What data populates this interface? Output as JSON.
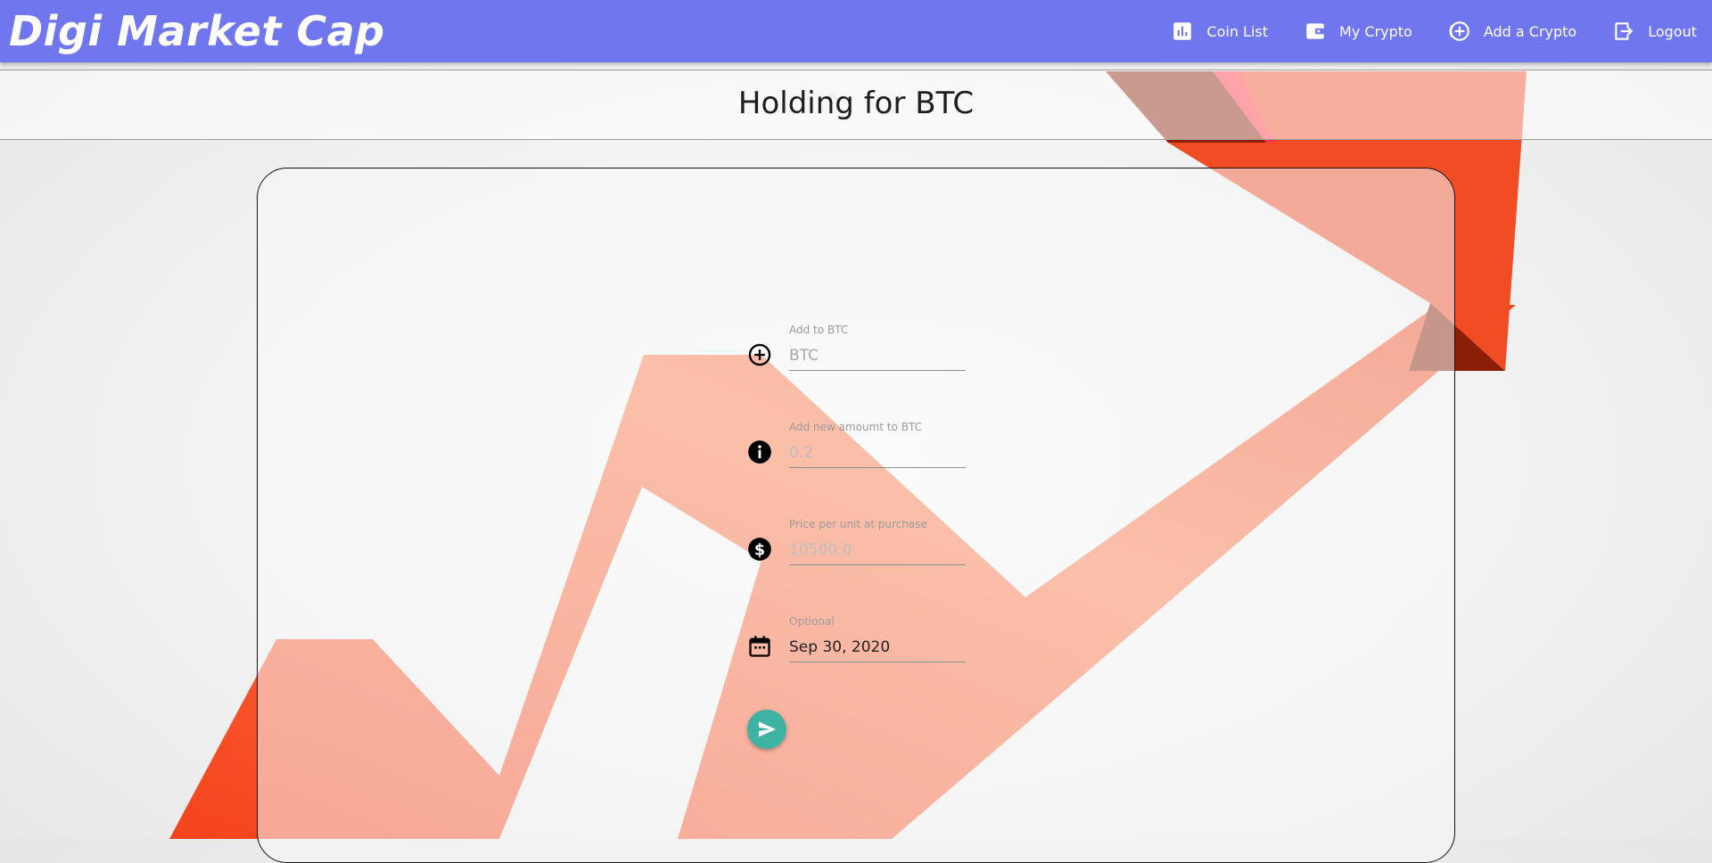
{
  "app": {
    "brand": "Digi Market Cap"
  },
  "nav": {
    "items": [
      {
        "label": "Coin List",
        "icon": "bar-chart-icon"
      },
      {
        "label": "My Crypto",
        "icon": "wallet-icon"
      },
      {
        "label": "Add a Crypto",
        "icon": "add-circle-icon"
      },
      {
        "label": "Logout",
        "icon": "logout-icon"
      }
    ]
  },
  "page": {
    "title": "Holding for BTC"
  },
  "form": {
    "coin": {
      "label": "Add to BTC",
      "value": "BTC",
      "icon": "add-circle-outline-icon"
    },
    "amount": {
      "label": "Add new amoumt to BTC",
      "placeholder": "0.2",
      "icon": "info-icon"
    },
    "price": {
      "label": "Price per unit at purchase",
      "placeholder": "10500.0",
      "icon": "dollar-circle-icon"
    },
    "date": {
      "label": "Optional",
      "value": "Sep 30, 2020",
      "icon": "calendar-icon"
    },
    "submit": {
      "icon": "send-icon"
    }
  },
  "colors": {
    "topbar": "#7077ee",
    "accent_button": "#3fb3a3",
    "arrow": "#f0522a"
  }
}
